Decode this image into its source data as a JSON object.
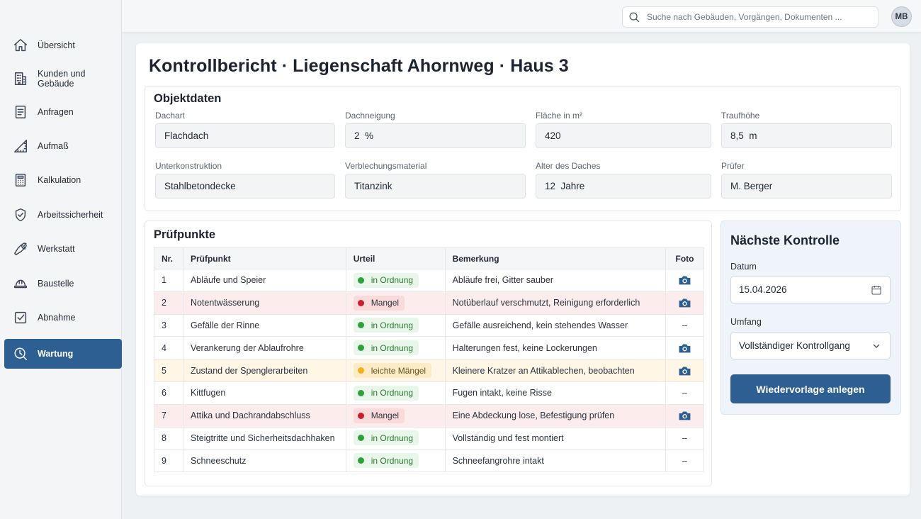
{
  "sidebar": {
    "items": [
      {
        "label": "Übersicht",
        "icon": "home-icon"
      },
      {
        "label": "Kunden und Gebäude",
        "icon": "building-icon"
      },
      {
        "label": "Anfragen",
        "icon": "document-icon"
      },
      {
        "label": "Aufmaß",
        "icon": "ruler-icon"
      },
      {
        "label": "Kalkulation",
        "icon": "calculator-icon"
      },
      {
        "label": "Arbeitssicherheit",
        "icon": "shield-check-icon"
      },
      {
        "label": "Werkstatt",
        "icon": "wrench-icon"
      },
      {
        "label": "Baustelle",
        "icon": "hardhat-icon"
      },
      {
        "label": "Abnahme",
        "icon": "checkbox-icon"
      },
      {
        "label": "Wartung",
        "icon": "maintenance-clock-icon",
        "active": true
      }
    ]
  },
  "topbar": {
    "search_placeholder": "Suche nach Gebäuden, Vorgängen, Dokumenten ...",
    "avatar_initials": "MB"
  },
  "page": {
    "title": "Kontrollbericht · Liegenschaft Ahornweg · Haus 3"
  },
  "objektdaten": {
    "title": "Objektdaten",
    "fields": [
      {
        "label": "Dachart",
        "value": "Flachdach"
      },
      {
        "label": "Dachneigung",
        "value": "2  %"
      },
      {
        "label": "Fläche in m²",
        "value": "420"
      },
      {
        "label": "Traufhöhe",
        "value": "8,5  m"
      },
      {
        "label": "Unterkonstruktion",
        "value": "Stahlbetondecke"
      },
      {
        "label": "Verblechungsmaterial",
        "value": "Titanzink"
      },
      {
        "label": "Alter des Daches",
        "value": "12  Jahre"
      },
      {
        "label": "Prüfer",
        "value": "M. Berger"
      }
    ]
  },
  "pruefpunkte": {
    "title": "Prüfpunkte",
    "columns": [
      "Nr.",
      "Prüfpunkt",
      "Urteil",
      "Bemerkung",
      "Foto"
    ],
    "rows": [
      {
        "nr": "1",
        "punkt": "Abläufe und Speier",
        "urteil": "in Ordnung",
        "status": "ok",
        "bemerkung": "Abläufe frei, Gitter sauber",
        "foto": true
      },
      {
        "nr": "2",
        "punkt": "Notentwässerung",
        "urteil": "Mangel",
        "status": "bad",
        "bemerkung": "Notüberlauf verschmutzt, Reinigung erforderlich",
        "foto": true
      },
      {
        "nr": "3",
        "punkt": "Gefälle der Rinne",
        "urteil": "in Ordnung",
        "status": "ok",
        "bemerkung": "Gefälle ausreichend, kein stehendes Wasser",
        "foto": false
      },
      {
        "nr": "4",
        "punkt": "Verankerung der Ablaufrohre",
        "urteil": "in Ordnung",
        "status": "ok",
        "bemerkung": "Halterungen fest, keine Lockerungen",
        "foto": true
      },
      {
        "nr": "5",
        "punkt": "Zustand der Spenglerarbeiten",
        "urteil": "leichte Mängel",
        "status": "warn",
        "bemerkung": "Kleinere Kratzer an Attikablechen, beobachten",
        "foto": true
      },
      {
        "nr": "6",
        "punkt": "Kittfugen",
        "urteil": "in Ordnung",
        "status": "ok",
        "bemerkung": "Fugen intakt, keine Risse",
        "foto": false
      },
      {
        "nr": "7",
        "punkt": "Attika und Dachrandabschluss",
        "urteil": "Mangel",
        "status": "bad",
        "bemerkung": "Eine Abdeckung lose, Befestigung prüfen",
        "foto": true
      },
      {
        "nr": "8",
        "punkt": "Steigtritte und Sicherheitsdachhaken",
        "urteil": "in Ordnung",
        "status": "ok",
        "bemerkung": "Vollständig und fest montiert",
        "foto": false
      },
      {
        "nr": "9",
        "punkt": "Schneeschutz",
        "urteil": "in Ordnung",
        "status": "ok",
        "bemerkung": "Schneefangrohre intakt",
        "foto": false
      }
    ],
    "no_photo_text": "–"
  },
  "naechste_kontrolle": {
    "title": "Nächste Kontrolle",
    "datum_label": "Datum",
    "datum_value": "15.04.2026",
    "umfang_label": "Umfang",
    "umfang_value": "Vollständiger Kontrollgang",
    "button_label": "Wiedervorlage anlegen"
  },
  "colors": {
    "accent": "#2d5f93",
    "ok": "#2fa03a",
    "bad": "#c8202a",
    "warn": "#f2b01e"
  }
}
